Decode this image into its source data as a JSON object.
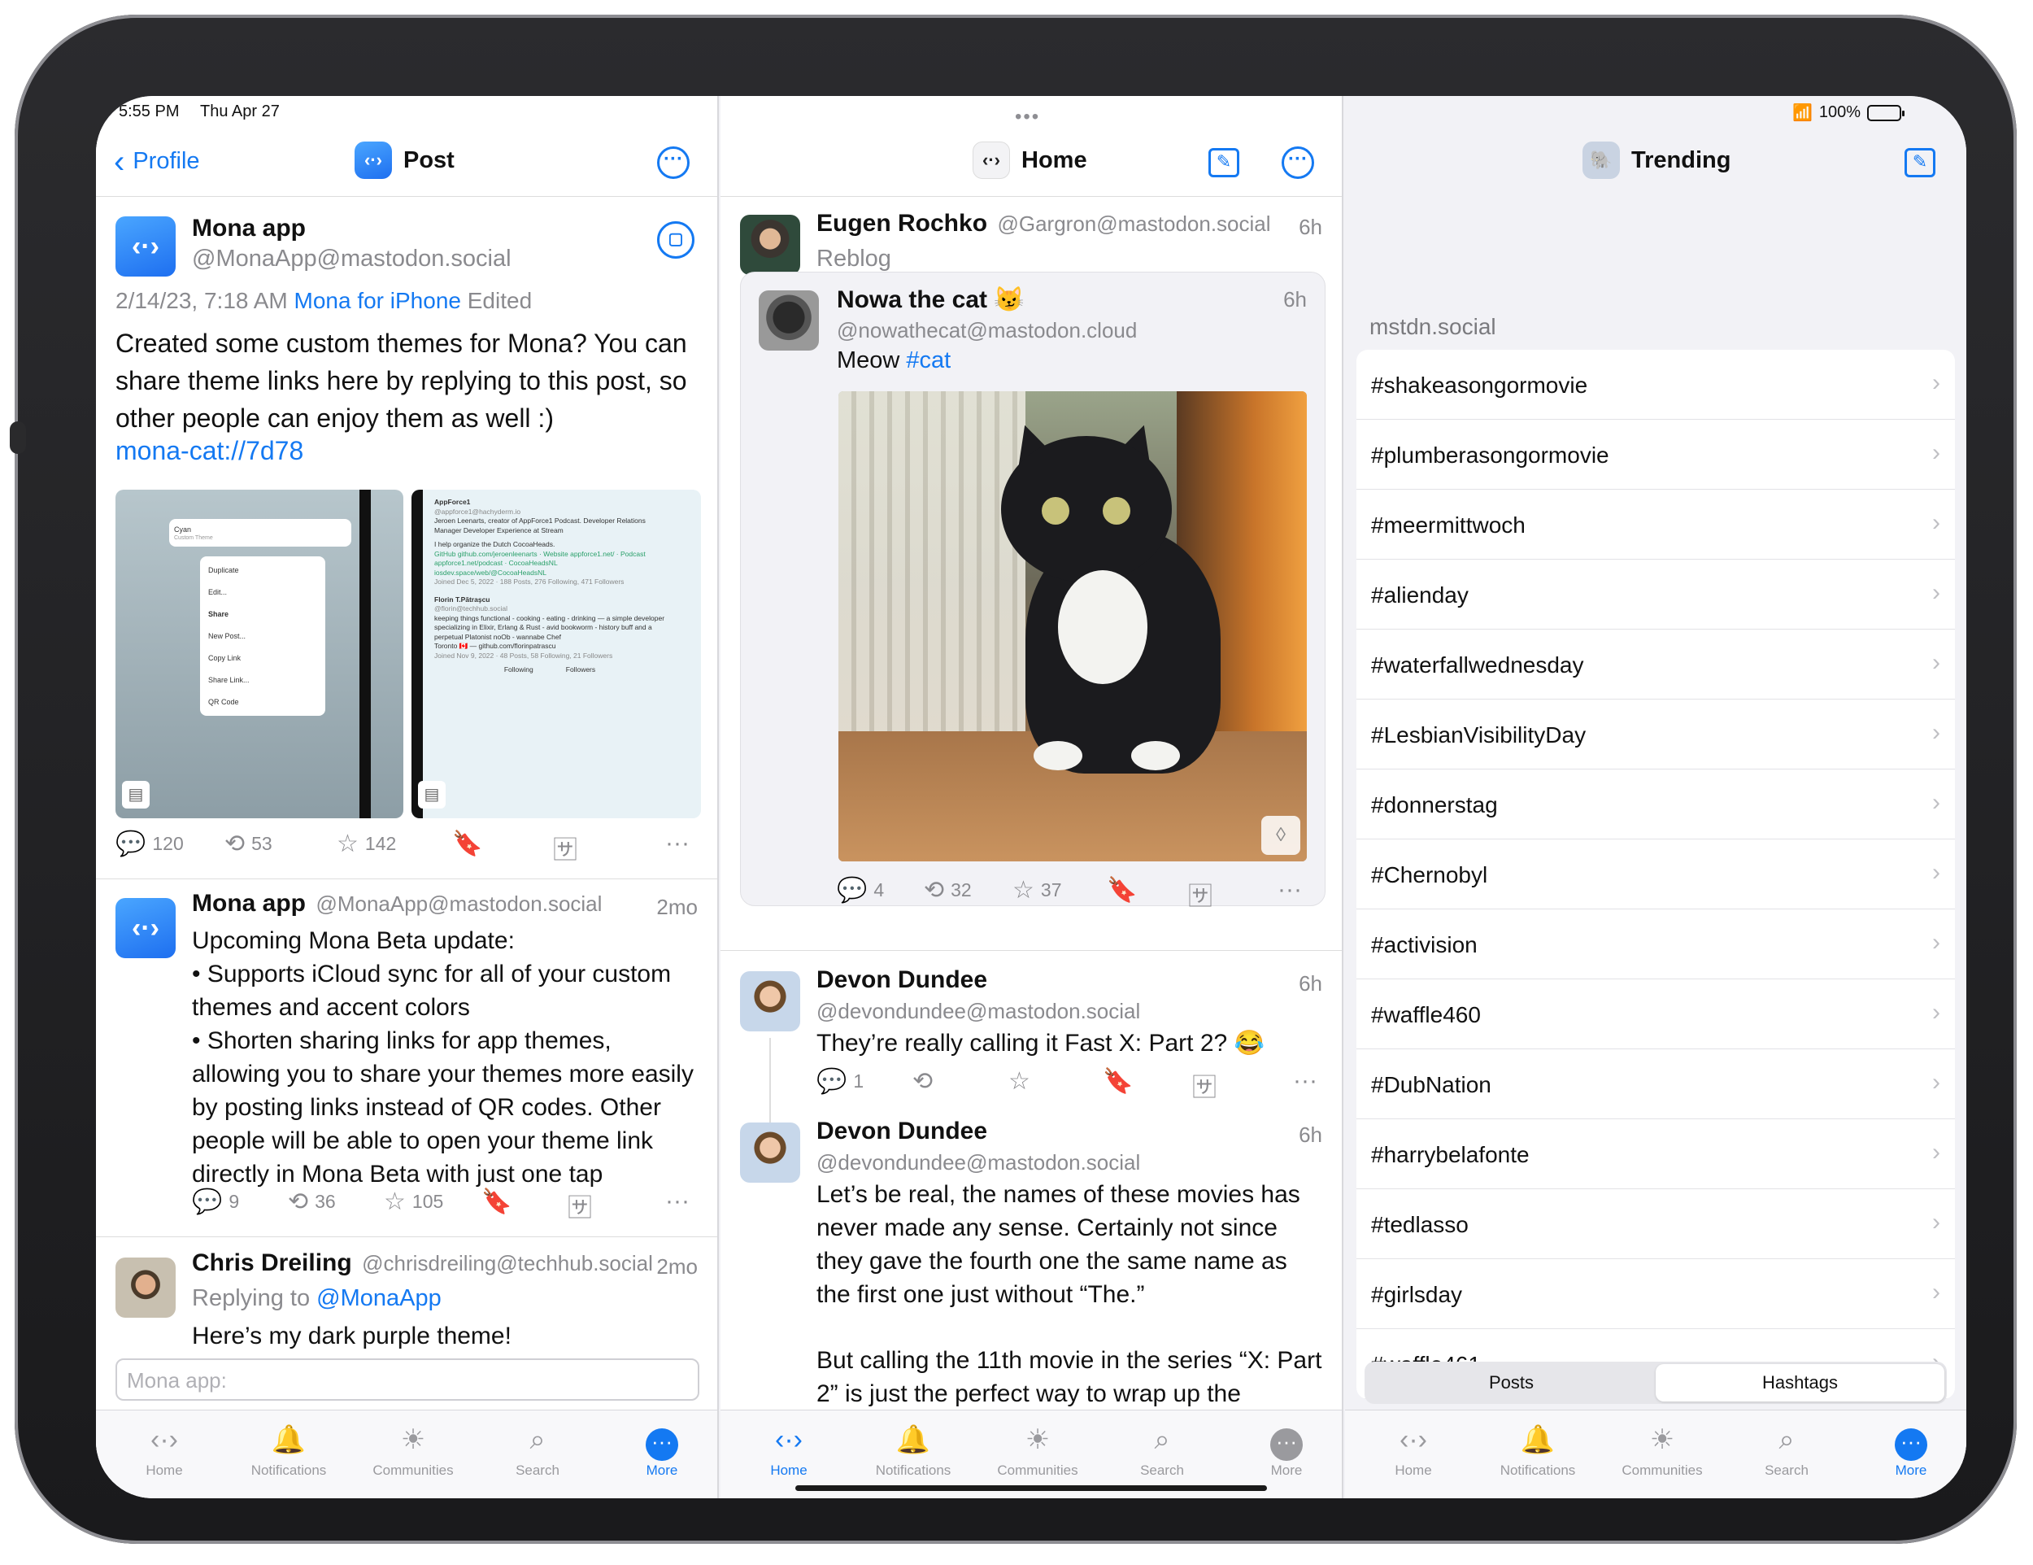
{
  "status": {
    "time": "5:55 PM",
    "date": "Thu Apr 27",
    "battery": "100%"
  },
  "col1": {
    "back_label": "Profile",
    "title": "Post",
    "post": {
      "author": "Mona app",
      "handle": "@MonaApp@mastodon.social",
      "date": "2/14/23, 7:18 AM",
      "via": "Mona for iPhone",
      "edited": "Edited",
      "text": "Created some custom themes for Mona? You can share theme links here by replying to this post, so other people can enjoy them as well :)",
      "link": "mona-cat://7d78",
      "replies": "120",
      "boosts": "53",
      "favs": "142",
      "shot1": {
        "title": "Cyan",
        "subtitle": "Custom Theme",
        "menu": [
          "Duplicate",
          "Edit...",
          "Share",
          "New Post...",
          "Copy Link",
          "Share Link...",
          "QR Code"
        ]
      },
      "shot2": {
        "name1": "AppForce1",
        "handle1": "@appforce1@hachyderm.io",
        "bio1": "Jeroen Leenarts, creator of AppForce1 Podcast. Developer Relations Manager Developer Experience at Stream",
        "bio1b": "I help organize the Dutch CocoaHeads.",
        "links1": "GitHub github.com/jeroenleenarts · Website appforce1.net/ · Podcast appforce1.net/podcast · CocoaHeadsNL iosdev.space/web/@CocoaHeadsNL",
        "meta1": "Joined Dec 5, 2022 · 188 Posts, 276 Following, 471 Followers",
        "name2": "Florin T.Pătraşcu",
        "handle2": "@florin@techhub.social",
        "bio2": "keeping things functional - cooking - eating - drinking — a simple developer specializing in Elixir, Erlang & Rust - avid bookworm - history buff and a perpetual Platonist noOb - wannabe Chef",
        "loc2": "Toronto 🇨🇦 — github.com/florinpatrascu",
        "meta2": "Joined Nov 9, 2022 · 48 Posts, 58 Following, 21 Followers",
        "tab1": "Following",
        "tab2": "Followers"
      }
    },
    "post2": {
      "author": "Mona app",
      "handle": "@MonaApp@mastodon.social",
      "ago": "2mo",
      "lines": [
        "Upcoming Mona Beta update:",
        "• Supports iCloud sync for all of your custom themes and accent colors",
        "• Shorten sharing links for app themes, allowing you to share your themes more easily by posting links instead of QR codes. Other people will be able to open your theme link directly in Mona Beta with just one tap"
      ],
      "replies": "9",
      "boosts": "36",
      "favs": "105"
    },
    "post3": {
      "author": "Chris Dreiling",
      "handle": "@chrisdreiling@techhub.social",
      "ago": "2mo",
      "replying_prefix": "Replying to",
      "replying_to": "@MonaApp",
      "text": "Here’s my dark purple theme!"
    },
    "reply_placeholder": "Mona app:"
  },
  "col2": {
    "title": "Home",
    "reblog": {
      "author": "Eugen Rochko",
      "handle": "@Gargron@mastodon.social",
      "ago": "6h",
      "label": "Reblog"
    },
    "inner": {
      "author": "Nowa the cat 😼",
      "handle": "@nowathecat@mastodon.cloud",
      "ago": "6h",
      "text": "Meow",
      "tag": "#cat",
      "replies": "4",
      "boosts": "32",
      "favs": "37"
    },
    "post2": {
      "author": "Devon Dundee",
      "handle": "@devondundee@mastodon.social",
      "ago": "6h",
      "text": "They’re really calling it Fast X: Part 2? 😂",
      "replies": "1"
    },
    "post3": {
      "author": "Devon Dundee",
      "handle": "@devondundee@mastodon.social",
      "ago": "6h",
      "text1": "Let’s be real, the names of these movies has never made any sense. Certainly not since they gave the fourth one the same name as the first one just without “The.”",
      "text2": "But calling the 11th movie in the series “X: Part 2” is just the perfect way to wrap up the"
    }
  },
  "col3": {
    "title": "Trending",
    "server": "mstdn.social",
    "tags": [
      "#shakeasongormovie",
      "#plumberasongormovie",
      "#meermittwoch",
      "#alienday",
      "#waterfallwednesday",
      "#LesbianVisibilityDay",
      "#donnerstag",
      "#Chernobyl",
      "#activision",
      "#waffle460",
      "#DubNation",
      "#harrybelafonte",
      "#tedlasso",
      "#girlsday",
      "#waffle461"
    ],
    "segments": [
      "Posts",
      "Hashtags"
    ]
  },
  "tabs": [
    "Home",
    "Notifications",
    "Communities",
    "Search",
    "More"
  ],
  "colors": {
    "accent": "#1479f2",
    "text": "#111111",
    "secondary": "#8a8a8e"
  }
}
